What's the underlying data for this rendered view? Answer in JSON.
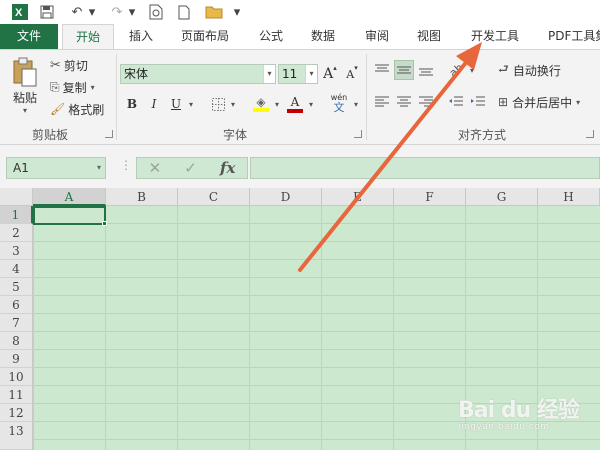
{
  "quick_access": {
    "icons": [
      "excel-logo-icon",
      "save-icon",
      "undo-icon",
      "redo-icon",
      "print-preview-icon",
      "new-file-icon",
      "open-folder-icon",
      "customize-icon"
    ]
  },
  "tabs": [
    {
      "label": "文件",
      "state": "file"
    },
    {
      "label": "开始",
      "state": "active"
    },
    {
      "label": "插入",
      "state": "normal"
    },
    {
      "label": "页面布局",
      "state": "normal"
    },
    {
      "label": "公式",
      "state": "normal"
    },
    {
      "label": "数据",
      "state": "normal"
    },
    {
      "label": "审阅",
      "state": "normal"
    },
    {
      "label": "视图",
      "state": "normal"
    },
    {
      "label": "开发工具",
      "state": "normal"
    },
    {
      "label": "PDF工具集",
      "state": "normal"
    }
  ],
  "clipboard": {
    "paste_label": "粘贴",
    "cut_label": "剪切",
    "copy_label": "复制",
    "format_painter_label": "格式刷",
    "group_label": "剪贴板"
  },
  "font": {
    "name_value": "宋体",
    "size_value": "11",
    "grow_label": "A",
    "shrink_label": "A",
    "bold_label": "B",
    "italic_label": "I",
    "underline_label": "U",
    "font_color_label": "A",
    "phonetic_label": "wén",
    "group_label": "字体"
  },
  "alignment": {
    "wrap_text_label": "自动换行",
    "merge_center_label": "合并后居中",
    "group_label": "对齐方式"
  },
  "formula_bar": {
    "name_box_value": "A1",
    "fx_label": "fx",
    "formula_value": ""
  },
  "sheet": {
    "columns": [
      "A",
      "B",
      "C",
      "D",
      "E",
      "F",
      "G",
      "H"
    ],
    "rows": [
      "1",
      "2",
      "3",
      "4",
      "5",
      "6",
      "7",
      "8",
      "9",
      "10",
      "11",
      "12",
      "13"
    ],
    "active_cell": "A1"
  },
  "watermark": {
    "logo_text": "Bai du 经验",
    "url_text": "jingyan.baidu.com"
  },
  "colors": {
    "accent": "#217346",
    "sheet_background": "#cce8cf",
    "arrow": "#e8663c"
  }
}
